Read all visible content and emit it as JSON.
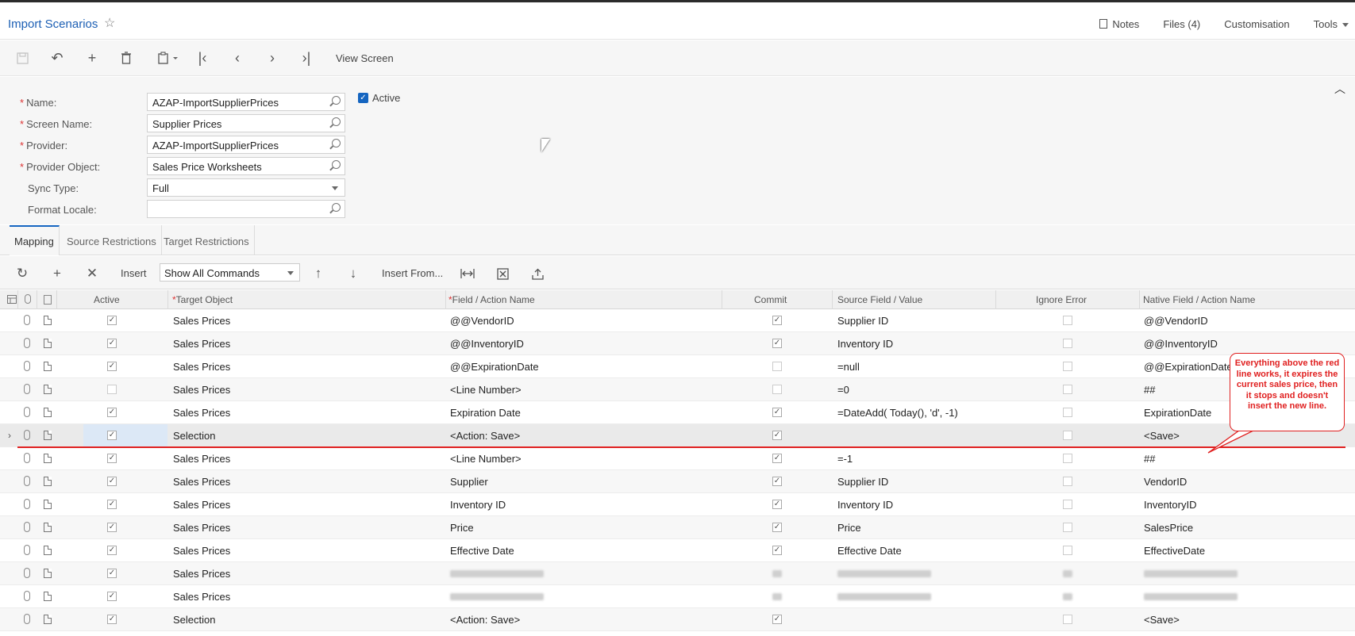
{
  "page": {
    "title": "Import Scenarios"
  },
  "toplinks": {
    "notes": "Notes",
    "files": "Files (4)",
    "customisation": "Customisation",
    "tools": "Tools"
  },
  "toolbar": {
    "view_screen": "View Screen"
  },
  "form": {
    "name_label": "Name:",
    "name_value": "AZAP-ImportSupplierPrices",
    "screen_name_label": "Screen Name:",
    "screen_name_value": "Supplier Prices",
    "provider_label": "Provider:",
    "provider_value": "AZAP-ImportSupplierPrices",
    "provider_object_label": "Provider Object:",
    "provider_object_value": "Sales Price Worksheets",
    "sync_type_label": "Sync Type:",
    "sync_type_value": "Full",
    "format_locale_label": "Format Locale:",
    "format_locale_value": "",
    "active_label": "Active",
    "active_checked": true
  },
  "tabs": [
    "Mapping",
    "Source Restrictions",
    "Target Restrictions"
  ],
  "gridbar": {
    "insert": "Insert",
    "command_filter": "Show All Commands",
    "insert_from": "Insert From..."
  },
  "grid": {
    "headers": {
      "active": "Active",
      "target_object": "Target Object",
      "field_action": "Field / Action Name",
      "commit": "Commit",
      "source_field": "Source Field / Value",
      "ignore_error": "Ignore Error",
      "native_field": "Native Field / Action Name"
    },
    "rows": [
      {
        "active": true,
        "target": "Sales Prices",
        "field": "@@VendorID",
        "commit": true,
        "source": "Supplier ID",
        "ignore": false,
        "native": "@@VendorID"
      },
      {
        "active": true,
        "target": "Sales Prices",
        "field": "@@InventoryID",
        "commit": true,
        "source": "Inventory ID",
        "ignore": false,
        "native": "@@InventoryID"
      },
      {
        "active": true,
        "target": "Sales Prices",
        "field": "@@ExpirationDate",
        "commit": false,
        "source": "=null",
        "ignore": false,
        "native": "@@ExpirationDate"
      },
      {
        "active": false,
        "target": "Sales Prices",
        "field": "<Line Number>",
        "commit": false,
        "source": "=0",
        "ignore": false,
        "native": "##"
      },
      {
        "active": true,
        "target": "Sales Prices",
        "field": "Expiration Date",
        "commit": true,
        "source": "=DateAdd( Today(), 'd', -1)",
        "ignore": false,
        "native": "ExpirationDate"
      },
      {
        "active": true,
        "target": "Selection",
        "field": "<Action: Save>",
        "commit": true,
        "source": "",
        "ignore": false,
        "native": "<Save>"
      },
      {
        "active": true,
        "target": "Sales Prices",
        "field": "<Line Number>",
        "commit": true,
        "source": "=-1",
        "ignore": false,
        "native": "##"
      },
      {
        "active": true,
        "target": "Sales Prices",
        "field": "Supplier",
        "commit": true,
        "source": "Supplier ID",
        "ignore": false,
        "native": "VendorID"
      },
      {
        "active": true,
        "target": "Sales Prices",
        "field": "Inventory ID",
        "commit": true,
        "source": "Inventory ID",
        "ignore": false,
        "native": "InventoryID"
      },
      {
        "active": true,
        "target": "Sales Prices",
        "field": "Price",
        "commit": true,
        "source": "Price",
        "ignore": false,
        "native": "SalesPrice"
      },
      {
        "active": true,
        "target": "Sales Prices",
        "field": "Effective Date",
        "commit": true,
        "source": "Effective Date",
        "ignore": false,
        "native": "EffectiveDate"
      },
      {
        "active": true,
        "target": "Sales Prices",
        "field": "",
        "commit": null,
        "source": "",
        "ignore": null,
        "native": ""
      },
      {
        "active": true,
        "target": "Sales Prices",
        "field": "",
        "commit": null,
        "source": "",
        "ignore": null,
        "native": ""
      },
      {
        "active": true,
        "target": "Selection",
        "field": "<Action: Save>",
        "commit": true,
        "source": "",
        "ignore": false,
        "native": "<Save>"
      }
    ]
  },
  "annotation": {
    "text": "Everything above the red line works, it expires the current sales price, then it stops and doesn't insert the new line."
  },
  "colors": {
    "accent": "#1565c0",
    "title": "#1c5fb4",
    "annotation_red": "#e02020"
  }
}
